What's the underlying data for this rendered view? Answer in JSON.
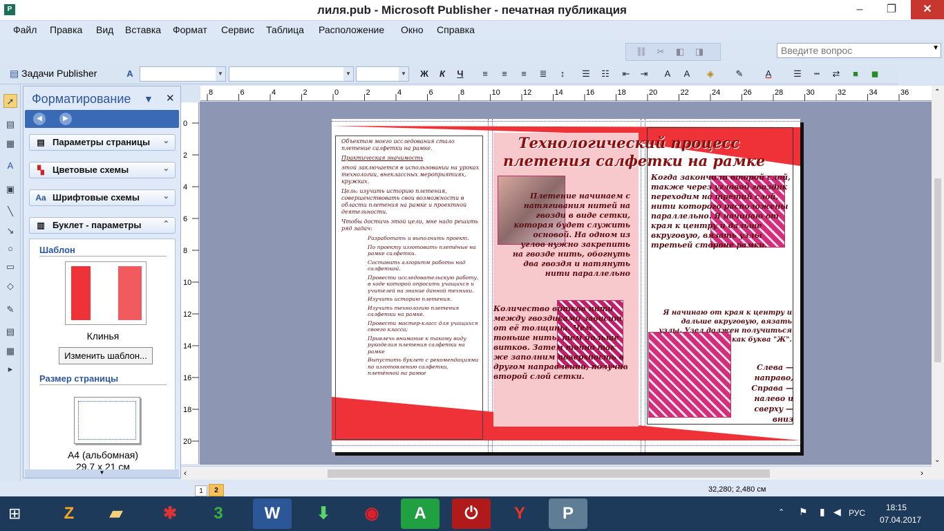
{
  "window": {
    "title": "лиля.pub - Microsoft Publisher - печатная публикация"
  },
  "menu": {
    "items": [
      "Файл",
      "Правка",
      "Вид",
      "Вставка",
      "Формат",
      "Сервис",
      "Таблица",
      "Расположение",
      "Окно",
      "Справка"
    ],
    "ask_placeholder": "Введите вопрос"
  },
  "toolbar": {
    "publisher_tasks": "Задачи Publisher",
    "bold": "Ж",
    "italic": "К",
    "underline": "Ч"
  },
  "taskpane": {
    "title": "Форматирование",
    "sections": [
      "Параметры страницы",
      "Цветовые схемы",
      "Шрифтовые схемы",
      "Буклет - параметры"
    ],
    "template_head": "Шаблон",
    "template_name": "Клинья",
    "change_template": "Изменить шаблон...",
    "page_size_head": "Размер страницы",
    "page_size_name": "А4 (альбомная)",
    "page_size_dims": "29,7 x 21 см"
  },
  "ruler": {
    "h": [
      "8",
      "6",
      "4",
      "2",
      "0",
      "2",
      "4",
      "6",
      "8",
      "10",
      "12",
      "14",
      "16",
      "18",
      "20",
      "22",
      "24",
      "26",
      "28",
      "30",
      "32",
      "34",
      "36"
    ],
    "v": [
      "0",
      "2",
      "4",
      "6",
      "8",
      "10",
      "12",
      "14",
      "16",
      "18",
      "20"
    ]
  },
  "publication": {
    "title1": "Технологический процесс",
    "title2": "плетения салфетки на рамке",
    "col1": [
      "Объектом моего исследования стало плетение салфетки на рамке.",
      "Практическая значимость",
      "этой заключается в использовании на уроках технологии, внеклассных мероприятиях, кружках.",
      "Цель: изучить историю плетения, совершенствовать свои возможности в области плетения на рамке и проектной деятельности.",
      "Чтобы достичь этой цели, мне надо решить ряд задач:"
    ],
    "col1_tasks": [
      "Разработать и выполнить проект.",
      "По проекту изготовить плетёные на рамке салфетки.",
      "Составить алгоритм работы над салфеткой.",
      "Провести исследовательскую работу, в ходе которой опросить учащихся и учителей на знание данной техники.",
      "Изучить историю плетения.",
      "Изучить технологию плетения салфетки на рамке.",
      "Провести мастер-класс для учащихся своего класса;",
      "Привлечь внимание к такому виду рукоделия плетения салфетки на рамке",
      "Выпустить буклет с рекомендациями по изготовлению салфетки, плетённой на рамке"
    ],
    "col2_a": "Плетение начинаем с натягивания нитей на гвозди в виде сетки, которая будет служить основой. На одном из углов нужно закрепить на гвозде нить, обогнуть два гвоздя и натянуть нити параллельно",
    "col2_b": "Количество витков нити между гвоздиками зависит от её толщины. Чем тоньше нить, тем больше витков. Затем точно так же заполним поверхность в другом направлении, получив второй слой сетки.",
    "col3_a": "Когда закончили второй слой, также через угловой гвоздик переходим на третий слой, нити которого расположены параллельно. Я начинаю от края к центру и дальше вкруговую, вязать узлы третьей стороне рамки.",
    "col3_b": "Я начинаю от края к центру и дальше вкруговую, вязать узлы. Узел должен получиться как буква \"Ж\".",
    "col3_c": "Слева — направо, Справа — налево и сверху — вниз"
  },
  "status": {
    "coords": "32,280; 2,480 см",
    "pages": [
      "1",
      "2"
    ]
  },
  "taskbar": {
    "lang": "РУС",
    "time": "18:15",
    "date": "07.04.2017"
  },
  "colors": {
    "accent_red": "#ee3237",
    "title_blue": "#2c56a3"
  }
}
